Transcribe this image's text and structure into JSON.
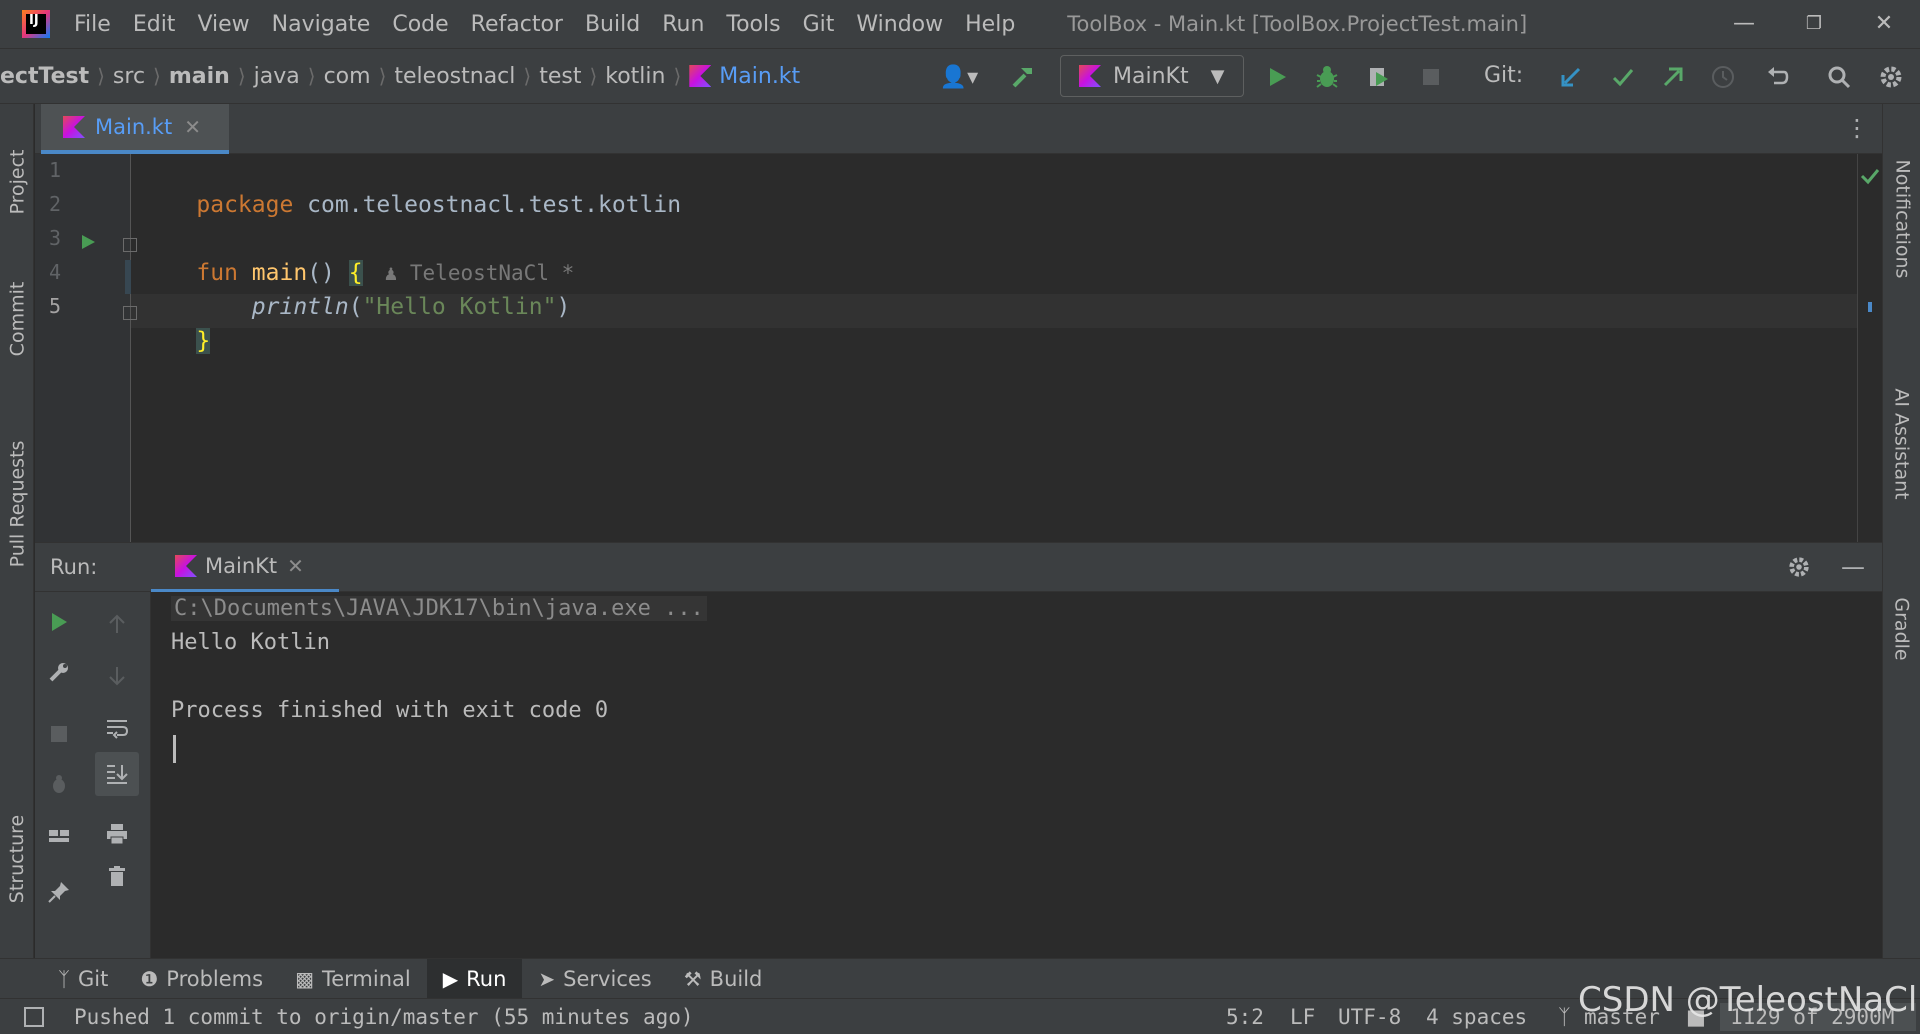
{
  "menu": {
    "items": [
      "File",
      "Edit",
      "View",
      "Navigate",
      "Code",
      "Refactor",
      "Build",
      "Run",
      "Tools",
      "Git",
      "Window",
      "Help"
    ],
    "window_title": "ToolBox - Main.kt [ToolBox.ProjectTest.main]"
  },
  "breadcrumbs": [
    "ectTest",
    "src",
    "main",
    "java",
    "com",
    "teleostnacl",
    "test",
    "kotlin",
    "Main.kt"
  ],
  "toolbar": {
    "run_config": "MainKt",
    "git_label": "Git:"
  },
  "editor": {
    "tab_label": "Main.kt",
    "line_numbers": [
      "1",
      "2",
      "3",
      "4",
      "5"
    ],
    "code": {
      "l1_kw": "package",
      "l1_rest": " com.teleostnacl.test.kotlin",
      "l3_kw": "fun",
      "l3_fn": " main",
      "l3_parens": "() ",
      "l3_brace": "{",
      "l3_author": "TeleostNaCl *",
      "l4_indent": "    ",
      "l4_call": "println",
      "l4_open": "(",
      "l4_str": "\"Hello Kotlin\"",
      "l4_close": ")",
      "l5_brace": "}"
    }
  },
  "left_strip": [
    "Project",
    "Commit",
    "Pull Requests",
    "Structure"
  ],
  "right_strip": [
    "Notifications",
    "AI Assistant",
    "Gradle"
  ],
  "run": {
    "label": "Run:",
    "tab_label": "MainKt",
    "console": [
      "C:\\Documents\\JAVA\\JDK17\\bin\\java.exe ...",
      "Hello Kotlin",
      "",
      "Process finished with exit code 0"
    ]
  },
  "bottom_tools": [
    "Git",
    "Problems",
    "Terminal",
    "Run",
    "Services",
    "Build"
  ],
  "status": {
    "message": "Pushed 1 commit to origin/master (55 minutes ago)",
    "position": "5:2",
    "line_sep": "LF",
    "encoding": "UTF-8",
    "indent": "4 spaces",
    "branch": "master",
    "memory": "1129 of 2900M"
  },
  "watermark": "CSDN @TeleostNaCl",
  "colors": {
    "accent": "#4a88c7",
    "run_green": "#499c54",
    "keyword": "#cc7832",
    "function": "#ffc66d",
    "string": "#6a8759"
  }
}
